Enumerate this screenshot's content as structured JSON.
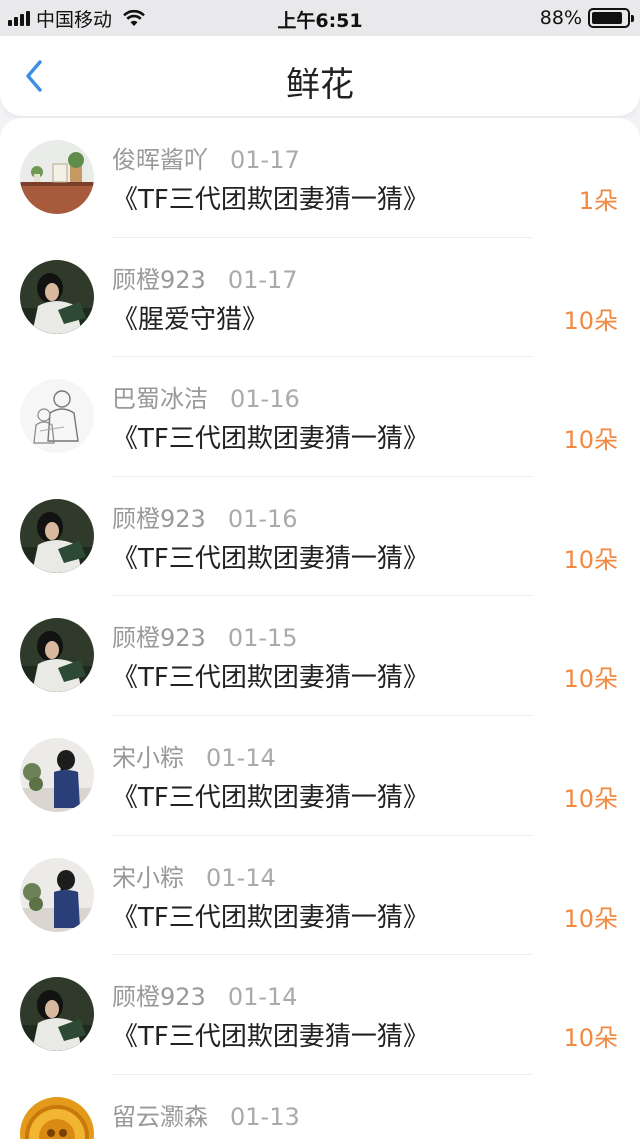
{
  "status_bar": {
    "carrier": "中国移动",
    "time": "上午6:51",
    "battery": "88%",
    "battery_level": 0.88
  },
  "header": {
    "title": "鲜花",
    "back_icon": "chevron-left-icon",
    "accent": "#3a8ee6"
  },
  "colors": {
    "count": "#f08a42",
    "username": "#999999"
  },
  "items": [
    {
      "user": "俊晖酱吖",
      "date": "01-17",
      "title": "《TF三代团欺团妻猜一猜》",
      "count": "1朵",
      "avatar": "room"
    },
    {
      "user": "顾橙923",
      "date": "01-17",
      "title": "《腥爱守猎》",
      "count": "10朵",
      "avatar": "dark-portrait"
    },
    {
      "user": "巴蜀冰洁",
      "date": "01-16",
      "title": "《TF三代团欺团妻猜一猜》",
      "count": "10朵",
      "avatar": "sketch"
    },
    {
      "user": "顾橙923",
      "date": "01-16",
      "title": "《TF三代团欺团妻猜一猜》",
      "count": "10朵",
      "avatar": "dark-portrait"
    },
    {
      "user": "顾橙923",
      "date": "01-15",
      "title": "《TF三代团欺团妻猜一猜》",
      "count": "10朵",
      "avatar": "dark-portrait"
    },
    {
      "user": "宋小粽",
      "date": "01-14",
      "title": "《TF三代团欺团妻猜一猜》",
      "count": "10朵",
      "avatar": "girl-back"
    },
    {
      "user": "宋小粽",
      "date": "01-14",
      "title": "《TF三代团欺团妻猜一猜》",
      "count": "10朵",
      "avatar": "girl-back"
    },
    {
      "user": "顾橙923",
      "date": "01-14",
      "title": "《TF三代团欺团妻猜一猜》",
      "count": "10朵",
      "avatar": "dark-portrait"
    },
    {
      "user": "留云灏森",
      "date": "01-13",
      "title": "",
      "count": "",
      "avatar": "golden-emblem"
    }
  ]
}
